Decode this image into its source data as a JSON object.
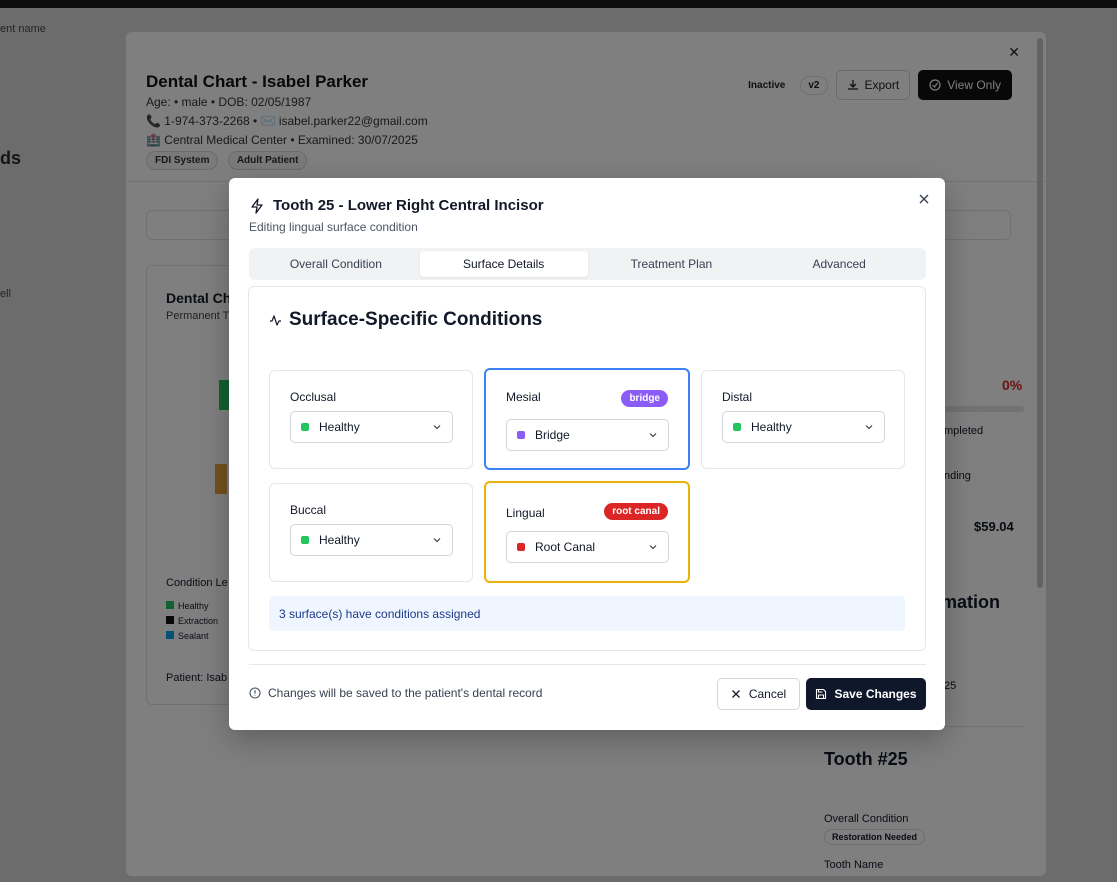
{
  "background": {
    "page_fragments": [
      "ds",
      "ent name",
      "ell"
    ],
    "outer": {
      "title": "Dental Chart - Isabel Parker",
      "line1": "Age: • male • DOB: 02/05/1987",
      "line2": "📞 1-974-373-2268 • ✉️ isabel.parker22@gmail.com",
      "line3": "🏥 Central Medical Center • Examined: 30/07/2025",
      "chips": [
        "FDI System",
        "Adult Patient"
      ],
      "status_badge": "Inactive",
      "version_badge": "v2",
      "export_label": "Export",
      "view_only_label": "View Only",
      "left_card_title": "Dental Ch",
      "left_card_sub": "Permanent T",
      "legend_title": "Condition Le",
      "legend_items": [
        {
          "label": "Healthy",
          "color": "#22c55e"
        },
        {
          "label": "Extraction",
          "color": "#111111"
        },
        {
          "label": "Sealant",
          "color": "#0ea5e9"
        }
      ],
      "patient_label": "Patient: Isab",
      "right_percent": "0%",
      "right_completed": "mpleted",
      "right_pending": "nding",
      "right_amount": "$59.04",
      "right_info": "mation",
      "right_date": "25",
      "right_tooth_title": "Tooth #25",
      "right_overall_label": "Overall Condition",
      "right_overall_badge": "Restoration Needed",
      "right_tooth_name_label": "Tooth Name"
    }
  },
  "dialog": {
    "title": "Tooth 25 - Lower Right Central Incisor",
    "subtitle": "Editing lingual surface condition",
    "tabs": [
      {
        "label": "Overall Condition",
        "active": false
      },
      {
        "label": "Surface Details",
        "active": true
      },
      {
        "label": "Treatment Plan",
        "active": false
      },
      {
        "label": "Advanced",
        "active": false
      }
    ],
    "panel_title": "Surface-Specific Conditions",
    "surfaces": [
      {
        "name": "Occlusal",
        "value": "Healthy",
        "swatch": "#22c55e",
        "badge": null
      },
      {
        "name": "Mesial",
        "value": "Bridge",
        "swatch": "#8b5cf6",
        "badge": "bridge",
        "badge_color": "#8b5cf6",
        "highlight": "#3b82f6"
      },
      {
        "name": "Distal",
        "value": "Healthy",
        "swatch": "#22c55e",
        "badge": null
      },
      {
        "name": "Buccal",
        "value": "Healthy",
        "swatch": "#22c55e",
        "badge": null
      },
      {
        "name": "Lingual",
        "value": "Root Canal",
        "swatch": "#dc2626",
        "badge": "root canal",
        "badge_color": "#dc2626",
        "highlight": "#eab308"
      }
    ],
    "summary": "3 surface(s) have conditions assigned",
    "footer_note": "Changes will be saved to the patient's dental record",
    "cancel_label": "Cancel",
    "save_label": "Save Changes"
  }
}
